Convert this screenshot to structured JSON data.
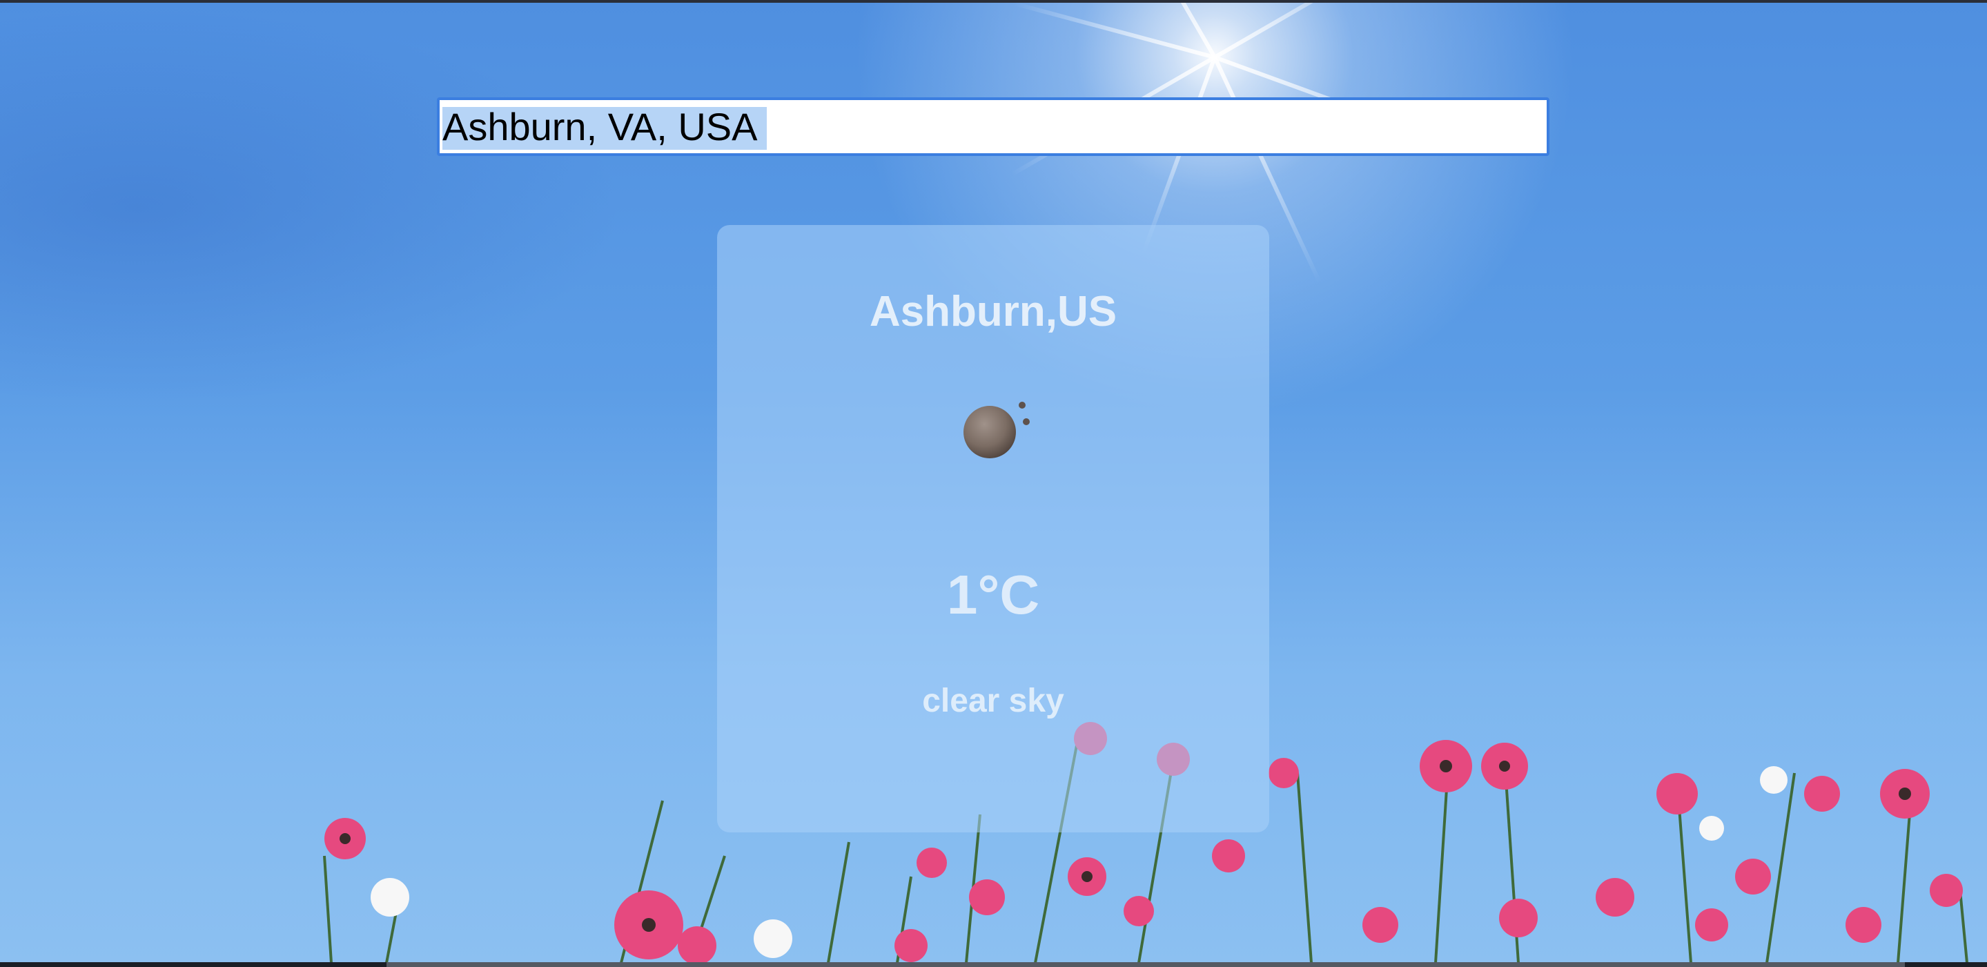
{
  "search": {
    "value": "Ashburn, VA, USA"
  },
  "weather": {
    "city": "Ashburn,US",
    "icon": "night-clear-moon-icon",
    "temperature": "1°C",
    "description": "clear sky"
  },
  "background": {
    "scene": "sunny-sky-with-pink-cosmos-flowers",
    "sky_color": "#5c9de6",
    "flower_color": "#e0457f"
  },
  "colors": {
    "input_border": "#3b7ee0",
    "selection": "#b6d4f6",
    "card_tint": "#aad2fa"
  }
}
